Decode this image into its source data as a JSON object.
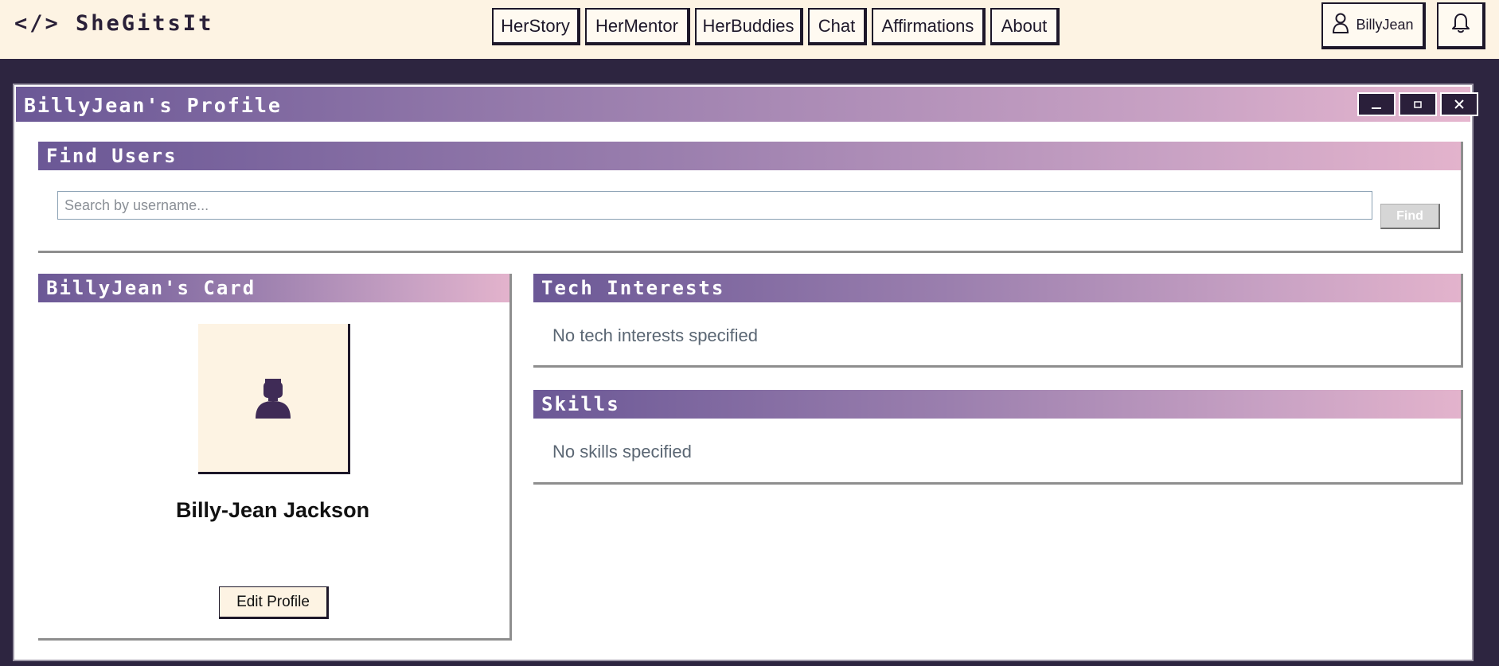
{
  "app": {
    "logo_text": "</> SheGitsIt"
  },
  "nav": {
    "items": [
      "HerStory",
      "HerMentor",
      "HerBuddies",
      "Chat",
      "Affirmations",
      "About"
    ]
  },
  "user": {
    "name": "BillyJean",
    "icon": "user-icon"
  },
  "notifications": {
    "icon": "bell-icon"
  },
  "window": {
    "title": "BillyJean's Profile",
    "controls": [
      "minimize-icon",
      "maximize-icon",
      "close-icon"
    ]
  },
  "find_users": {
    "title": "Find Users",
    "search_placeholder": "Search by username...",
    "search_value": "",
    "find_label": "Find"
  },
  "card": {
    "title": "BillyJean's Card",
    "full_name": "Billy-Jean Jackson",
    "edit_label": "Edit Profile",
    "avatar_icon": "avatar-silhouette-icon"
  },
  "tech_interests": {
    "title": "Tech Interests",
    "empty_text": "No tech interests specified"
  },
  "skills": {
    "title": "Skills",
    "empty_text": "No skills specified"
  },
  "colors": {
    "topbar_bg": "#fdf3e3",
    "page_bg": "#2d2540",
    "header_gradient_start": "#6b5896",
    "header_gradient_end": "#e6b6cf",
    "dark": "#1d1729"
  }
}
